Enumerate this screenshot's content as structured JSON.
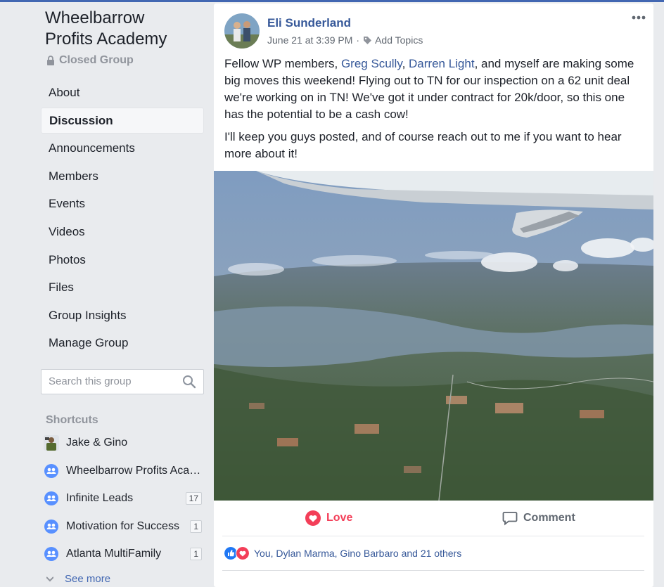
{
  "group": {
    "title_line1": "Wheelbarrow",
    "title_line2": "Profits Academy",
    "privacy": "Closed Group"
  },
  "nav": {
    "items": [
      {
        "label": "About"
      },
      {
        "label": "Discussion",
        "active": true
      },
      {
        "label": "Announcements"
      },
      {
        "label": "Members"
      },
      {
        "label": "Events"
      },
      {
        "label": "Videos"
      },
      {
        "label": "Photos"
      },
      {
        "label": "Files"
      },
      {
        "label": "Group Insights"
      },
      {
        "label": "Manage Group"
      }
    ]
  },
  "search": {
    "placeholder": "Search this group"
  },
  "shortcuts": {
    "heading": "Shortcuts",
    "items": [
      {
        "label": "Jake & Gino",
        "count": "",
        "icon": "person-avatar-icon"
      },
      {
        "label": "Wheelbarrow Profits Academy",
        "count": "",
        "icon": "group-icon"
      },
      {
        "label": "Infinite Leads",
        "count": "17",
        "icon": "group-icon"
      },
      {
        "label": "Motivation for Success",
        "count": "1",
        "icon": "group-icon"
      },
      {
        "label": "Atlanta MultiFamily",
        "count": "1",
        "icon": "group-icon"
      }
    ],
    "see_more": "See more"
  },
  "post": {
    "author": "Eli Sunderland",
    "timestamp": "June 21 at 3:39 PM",
    "add_topics": "Add Topics",
    "p1_a": "Fellow WP members, ",
    "mention1": "Greg Scully",
    "p1_b": ", ",
    "mention2": "Darren Light",
    "p1_c": ", and myself are making some big moves this weekend! Flying out to TN for our inspection on a 62 unit deal we're working on in TN! We've got it under contract for 20k/door, so this one has the potential to be a cash cow!",
    "p2": "I'll keep you guys posted, and of course reach out to me if you want to hear more about it!",
    "love_label": "Love",
    "comment_label": "Comment",
    "reactions_text": "You, Dylan Marma, Gino Barbaro and 21 others"
  },
  "colors": {
    "link": "#365899",
    "love": "#f33e58",
    "like": "#2078f4",
    "accent": "#4267b2"
  }
}
